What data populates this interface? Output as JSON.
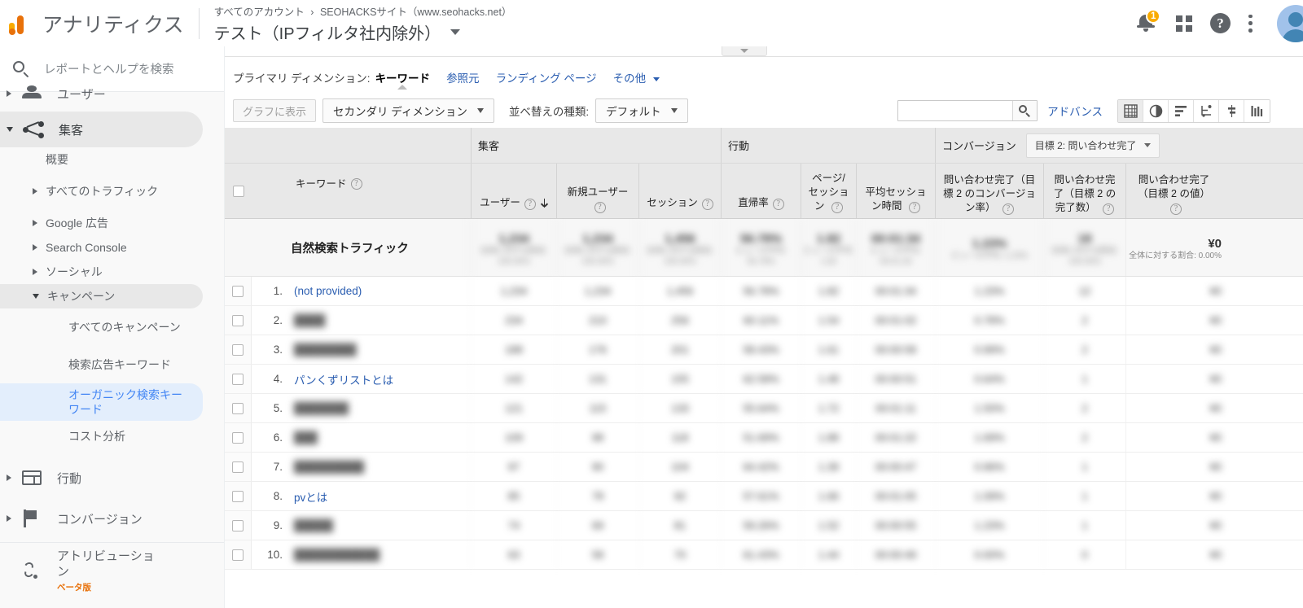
{
  "topbar": {
    "brand": "アナリティクス",
    "breadcrumb_all_accounts": "すべてのアカウント",
    "breadcrumb_sep": "›",
    "breadcrumb_property": "SEOHACKSサイト（www.seohacks.net）",
    "view_title": "テスト（IPフィルタ社内除外）",
    "notification_count": "1",
    "icons": {
      "bell": "notifications-icon",
      "apps": "apps-grid-icon",
      "help": "help-icon",
      "more": "kebab-menu-icon",
      "avatar": "account-avatar"
    }
  },
  "sidebar": {
    "search_placeholder": "レポートとヘルプを検索",
    "items": [
      {
        "label": "ユーザー",
        "icon": "user-icon",
        "level": 1,
        "expanded": false
      },
      {
        "label": "集客",
        "icon": "acquisition-icon",
        "level": 1,
        "expanded": true,
        "active": true
      },
      {
        "label": "概要",
        "level": 2
      },
      {
        "label": "すべてのトラフィック",
        "level": 2,
        "expandable": true
      },
      {
        "label": "Google 広告",
        "level": 2,
        "expandable": true
      },
      {
        "label": "Search Console",
        "level": 2,
        "expandable": true
      },
      {
        "label": "ソーシャル",
        "level": 2,
        "expandable": true
      },
      {
        "label": "キャンペーン",
        "level": 2,
        "expandable": true,
        "expanded": true,
        "active": true
      },
      {
        "label": "すべてのキャンペーン",
        "level": 3
      },
      {
        "label": "検索広告キーワード",
        "level": 3
      },
      {
        "label": "オーガニック検索キーワード",
        "level": 3,
        "selected": true
      },
      {
        "label": "コスト分析",
        "level": 3
      },
      {
        "label": "行動",
        "icon": "behavior-icon",
        "level": 1
      },
      {
        "label": "コンバージョン",
        "icon": "conversions-flag-icon",
        "level": 1
      },
      {
        "label": "アトリビューション",
        "icon": "attribution-icon",
        "level": 1,
        "badge": "ベータ版"
      }
    ]
  },
  "toolbar": {
    "primary_dimension_label": "プライマリ ディメンション:",
    "primary_dimension_current": "キーワード",
    "dimension_links": [
      "参照元",
      "ランディング ページ"
    ],
    "more_label": "その他",
    "plot_rows_label": "グラフに表示",
    "secondary_dimension_label": "セカンダリ ディメンション",
    "sort_type_label": "並べ替えの種類:",
    "sort_type_value": "デフォルト",
    "search_value": "",
    "advanced_label": "アドバンス",
    "view_icons": [
      "table-view-icon",
      "pie-chart-view-icon",
      "bar-chart-view-icon",
      "performance-view-icon",
      "comparison-view-icon",
      "pivot-view-icon"
    ],
    "active_view_icon": "table-view-icon"
  },
  "table": {
    "groups": [
      {
        "label": "",
        "key": "keyword"
      },
      {
        "label": "集客",
        "key": "acquisition"
      },
      {
        "label": "行動",
        "key": "behavior"
      },
      {
        "label": "コンバージョン",
        "key": "conversions"
      }
    ],
    "conversion_goal_selector": "目標 2: 問い合わせ完了",
    "columns": [
      {
        "label": "キーワード",
        "help": true,
        "align": "left"
      },
      {
        "label": "ユーザー",
        "help": true,
        "sorted": "desc"
      },
      {
        "label": "新規ユーザー",
        "help": true
      },
      {
        "label": "セッション",
        "help": true
      },
      {
        "label": "直帰率",
        "help": true
      },
      {
        "label": "ページ/セッション",
        "help": true
      },
      {
        "label": "平均セッション時間",
        "help": true
      },
      {
        "label": "問い合わせ完了（目標 2 のコンバージョン率）",
        "help": true
      },
      {
        "label": "問い合わせ完了（目標 2 の完了数）",
        "help": true
      },
      {
        "label": "問い合わせ完了（目標 2 の値）",
        "help": true
      }
    ],
    "total_row": {
      "label": "自然検索トラフィック",
      "values": [
        "1,234",
        "1,234",
        "1,456",
        "56.78%",
        "1.82",
        "00:01:34",
        "1.23%",
        "18",
        "¥0"
      ],
      "subtexts": [
        "全体に対する割合:\n100.00%",
        "全体に対する割合:\n100.00%",
        "全体に対する割合:\n100.00%",
        "ビューの平均:\n56.78%",
        "ビューの平均:\n1.82",
        "ビューの平均:\n00:01:34",
        "ビューの平均:\n1.23%",
        "全体に対する割合:\n100.00%",
        "全体に対する割合:\n0.00%"
      ],
      "blurred": true
    },
    "rows": [
      {
        "index": "1.",
        "keyword": "(not provided)",
        "blurred": false
      },
      {
        "index": "2.",
        "keyword": "████",
        "blurred": true
      },
      {
        "index": "3.",
        "keyword": "████████",
        "blurred": true
      },
      {
        "index": "4.",
        "keyword": "パンくずリストとは",
        "blurred": false
      },
      {
        "index": "5.",
        "keyword": "███████",
        "blurred": true
      },
      {
        "index": "6.",
        "keyword": "███",
        "blurred": true
      },
      {
        "index": "7.",
        "keyword": "█████████",
        "blurred": true
      },
      {
        "index": "8.",
        "keyword": "pvとは",
        "blurred": false
      },
      {
        "index": "9.",
        "keyword": "█████",
        "blurred": true
      },
      {
        "index": "10.",
        "keyword": "███████████",
        "blurred": true
      }
    ],
    "row_values": [
      [
        "1,234",
        "1,234",
        "1,456",
        "56.78%",
        "1.82",
        "00:01:34",
        "1.23%",
        "12",
        "¥0"
      ],
      [
        "234",
        "210",
        "256",
        "60.11%",
        "1.54",
        "00:01:02",
        "0.78%",
        "2",
        "¥0"
      ],
      [
        "188",
        "176",
        "201",
        "58.43%",
        "1.61",
        "00:00:58",
        "0.99%",
        "2",
        "¥0"
      ],
      [
        "142",
        "131",
        "155",
        "62.58%",
        "1.48",
        "00:00:51",
        "0.64%",
        "1",
        "¥0"
      ],
      [
        "121",
        "115",
        "133",
        "55.64%",
        "1.72",
        "00:01:11",
        "1.50%",
        "2",
        "¥0"
      ],
      [
        "109",
        "98",
        "118",
        "51.69%",
        "1.88",
        "00:01:22",
        "1.69%",
        "2",
        "¥0"
      ],
      [
        "97",
        "90",
        "104",
        "64.42%",
        "1.39",
        "00:00:47",
        "0.96%",
        "1",
        "¥0"
      ],
      [
        "85",
        "78",
        "92",
        "57.61%",
        "1.66",
        "00:01:05",
        "1.09%",
        "1",
        "¥0"
      ],
      [
        "74",
        "69",
        "81",
        "59.26%",
        "1.52",
        "00:00:55",
        "1.23%",
        "1",
        "¥0"
      ],
      [
        "63",
        "58",
        "70",
        "61.43%",
        "1.44",
        "00:00:49",
        "0.00%",
        "0",
        "¥0"
      ]
    ]
  },
  "colors": {
    "link": "#2a5db0",
    "accent_orange": "#e8710a",
    "badge_yellow": "#f9ab00",
    "selected_nav_bg": "#e3eefc",
    "selected_nav_text": "#4285f4"
  }
}
